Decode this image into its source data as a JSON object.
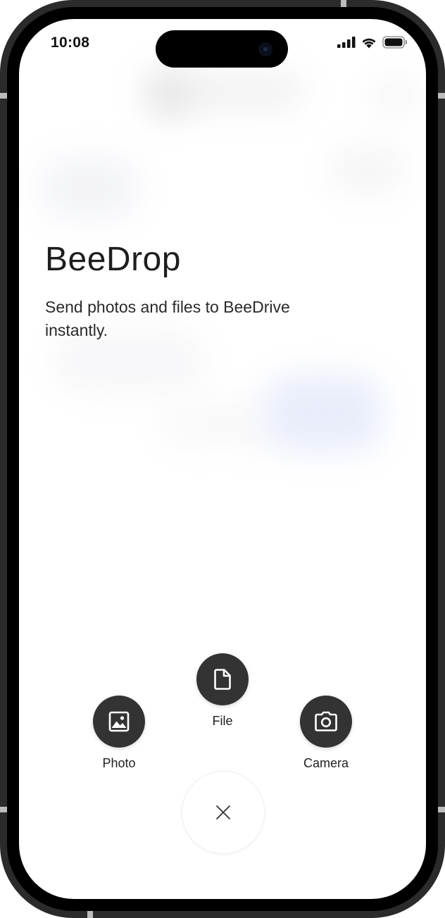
{
  "status_bar": {
    "time": "10:08",
    "icons": [
      "cellular-signal-icon",
      "wifi-icon",
      "battery-icon"
    ]
  },
  "app": {
    "title": "BeeDrop",
    "subtitle": "Send photos and files to BeeDrive instantly."
  },
  "actions": {
    "photo": {
      "label": "Photo",
      "icon": "image-icon"
    },
    "file": {
      "label": "File",
      "icon": "document-icon"
    },
    "camera": {
      "label": "Camera",
      "icon": "camera-icon"
    },
    "close": {
      "icon": "close-icon"
    }
  },
  "colors": {
    "action_button_bg": "#333333",
    "text_primary": "#1e1e1e",
    "screen_bg": "#ffffff",
    "frame": "#2b2b2b"
  }
}
